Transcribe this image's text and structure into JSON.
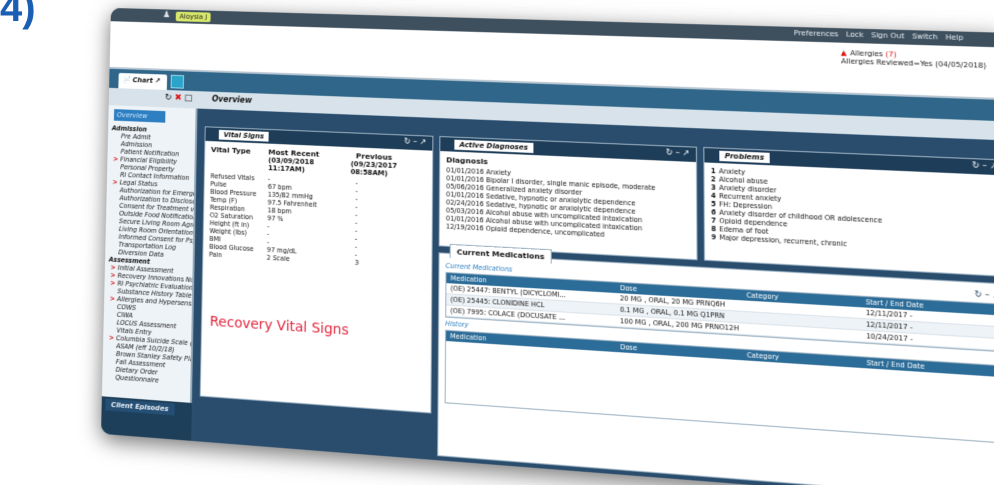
{
  "slide_label": "4)",
  "topbar": {
    "patient_name": "Aloysia J",
    "menus": [
      "Preferences",
      "Lock",
      "Sign Out",
      "Switch",
      "Help"
    ]
  },
  "allergies": {
    "label": "Allergies",
    "count": "(7)",
    "reviewed": "Allergies Reviewed=Yes (04/05/2018)"
  },
  "tabs": {
    "chart": "Chart"
  },
  "subbar": {
    "title": "Overview"
  },
  "sidebar": {
    "overview": "Overview",
    "items": [
      {
        "text": "Admission",
        "kind": "head"
      },
      {
        "text": "Pre Admit",
        "kind": "item"
      },
      {
        "text": "Admission",
        "kind": "item"
      },
      {
        "text": "Patient Notification",
        "kind": "item"
      },
      {
        "text": "Financial Eligibility",
        "kind": "arrow"
      },
      {
        "text": "Personal Property",
        "kind": "item"
      },
      {
        "text": "RI Contact Information",
        "kind": "item"
      },
      {
        "text": "Legal Status",
        "kind": "arrow"
      },
      {
        "text": "Authorization for Emergency Medi",
        "kind": "item"
      },
      {
        "text": "Authorization to Disclose v2",
        "kind": "item"
      },
      {
        "text": "Consent for Treatment v2",
        "kind": "item"
      },
      {
        "text": "Outside Food Notification",
        "kind": "item"
      },
      {
        "text": "Secure Living Room Agreement",
        "kind": "item"
      },
      {
        "text": "Living Room Orientation",
        "kind": "item"
      },
      {
        "text": "Informed Consent for Psychotropi",
        "kind": "item"
      },
      {
        "text": "Transportation Log",
        "kind": "item"
      },
      {
        "text": "Diversion Data",
        "kind": "item"
      },
      {
        "text": "Assessment",
        "kind": "head"
      },
      {
        "text": "Initial Assessment",
        "kind": "arrow"
      },
      {
        "text": "Recovery Innovations Nursing Ass",
        "kind": "arrow"
      },
      {
        "text": "RI Psychiatric Evaluation v2",
        "kind": "arrow"
      },
      {
        "text": "Substance History Table",
        "kind": "item"
      },
      {
        "text": "Allergies and Hypersensitivities",
        "kind": "arrow"
      },
      {
        "text": "COWS",
        "kind": "item"
      },
      {
        "text": "CIWA",
        "kind": "item"
      },
      {
        "text": "LOCUS Assessment",
        "kind": "item"
      },
      {
        "text": "Vitals Entry",
        "kind": "item"
      },
      {
        "text": "Columbia Suicide Scale (eff. 12/1/1",
        "kind": "arrow"
      },
      {
        "text": "ASAM (eff 10/2/18)",
        "kind": "item"
      },
      {
        "text": "Brown Stanley Safety Plan",
        "kind": "item"
      },
      {
        "text": "Fall Assessment",
        "kind": "item"
      },
      {
        "text": "Dietary Order",
        "kind": "item"
      },
      {
        "text": "Questionnaire",
        "kind": "item"
      }
    ],
    "client_episodes": "Client Episodes"
  },
  "vitals": {
    "title": "Vital Signs",
    "col_type": "Vital Type",
    "col_recent": "Most Recent",
    "col_previous": "Previous",
    "recent_date": "(03/09/2018 11:17AM)",
    "previous_date": "(09/23/2017 08:58AM)",
    "rows": [
      {
        "type": "Refused Vitals",
        "recent": "-",
        "previous": "-"
      },
      {
        "type": "Pulse",
        "recent": "67 bpm",
        "previous": "-"
      },
      {
        "type": "Blood Pressure",
        "recent": "135/82 mmHg",
        "previous": "-"
      },
      {
        "type": "Temp (F)",
        "recent": "97.5 Fahrenheit",
        "previous": "-"
      },
      {
        "type": "Respiration",
        "recent": "18 bpm",
        "previous": "-"
      },
      {
        "type": "O2 Saturation",
        "recent": "97 %",
        "previous": "-"
      },
      {
        "type": "Height (ft in)",
        "recent": "-",
        "previous": "-"
      },
      {
        "type": "Weight (lbs)",
        "recent": "-",
        "previous": "-"
      },
      {
        "type": "BMI",
        "recent": "-",
        "previous": "-"
      },
      {
        "type": "Blood Glucose",
        "recent": "97 mg/dL",
        "previous": "-"
      },
      {
        "type": "Pain",
        "recent": "2 Scale",
        "previous": "3"
      }
    ],
    "annotation": "Recovery Vital Signs"
  },
  "diagnoses": {
    "title": "Active Diagnoses",
    "header": "Diagnosis",
    "items": [
      "01/01/2016 Anxiety",
      "01/01/2016 Bipolar I disorder, single manic episode, moderate",
      "05/06/2016 Generalized anxiety disorder",
      "01/01/2016 Sedative, hypnotic or anxiolytic dependence",
      "02/24/2016 Sedative, hypnotic or anxiolytic dependence",
      "05/03/2016 Alcohol abuse with uncomplicated intoxication",
      "01/01/2016 Alcohol abuse with uncomplicated intoxication",
      "12/19/2016 Opioid dependence, uncomplicated"
    ]
  },
  "problems": {
    "title": "Problems",
    "items": [
      {
        "num": "1",
        "text": "Anxiety"
      },
      {
        "num": "2",
        "text": "Alcohol abuse"
      },
      {
        "num": "3",
        "text": "Anxiety disorder"
      },
      {
        "num": "4",
        "text": "Recurrent anxiety"
      },
      {
        "num": "5",
        "text": "FH: Depression"
      },
      {
        "num": "6",
        "text": "Anxiety disorder of childhood OR adolescence"
      },
      {
        "num": "7",
        "text": "Opioid dependence"
      },
      {
        "num": "8",
        "text": "Edema of foot"
      },
      {
        "num": "9",
        "text": "Major depression, recurrent, chronic"
      }
    ]
  },
  "medications": {
    "tab": "Current Medications",
    "current_label": "Current Medications",
    "history_label": "History",
    "columns": [
      "Medication",
      "Dose",
      "Category",
      "Start / End Date"
    ],
    "current_rows": [
      {
        "med": "(OE) 25447: BENTYL (DICYCLOMI...",
        "dose": "20 MG , ORAL, 20 MG PRNQ6H",
        "category": "",
        "date": "12/11/2017 -"
      },
      {
        "med": "(OE) 25445: CLONIDINE HCL",
        "dose": "0.1 MG , ORAL, 0.1 MG Q1PRN",
        "category": "",
        "date": "12/11/2017 -"
      },
      {
        "med": "(OE) 7995: COLACE (DOCUSATE ...",
        "dose": "100 MG , ORAL, 200 MG PRNO12H",
        "category": "",
        "date": "10/24/2017 -"
      }
    ]
  }
}
